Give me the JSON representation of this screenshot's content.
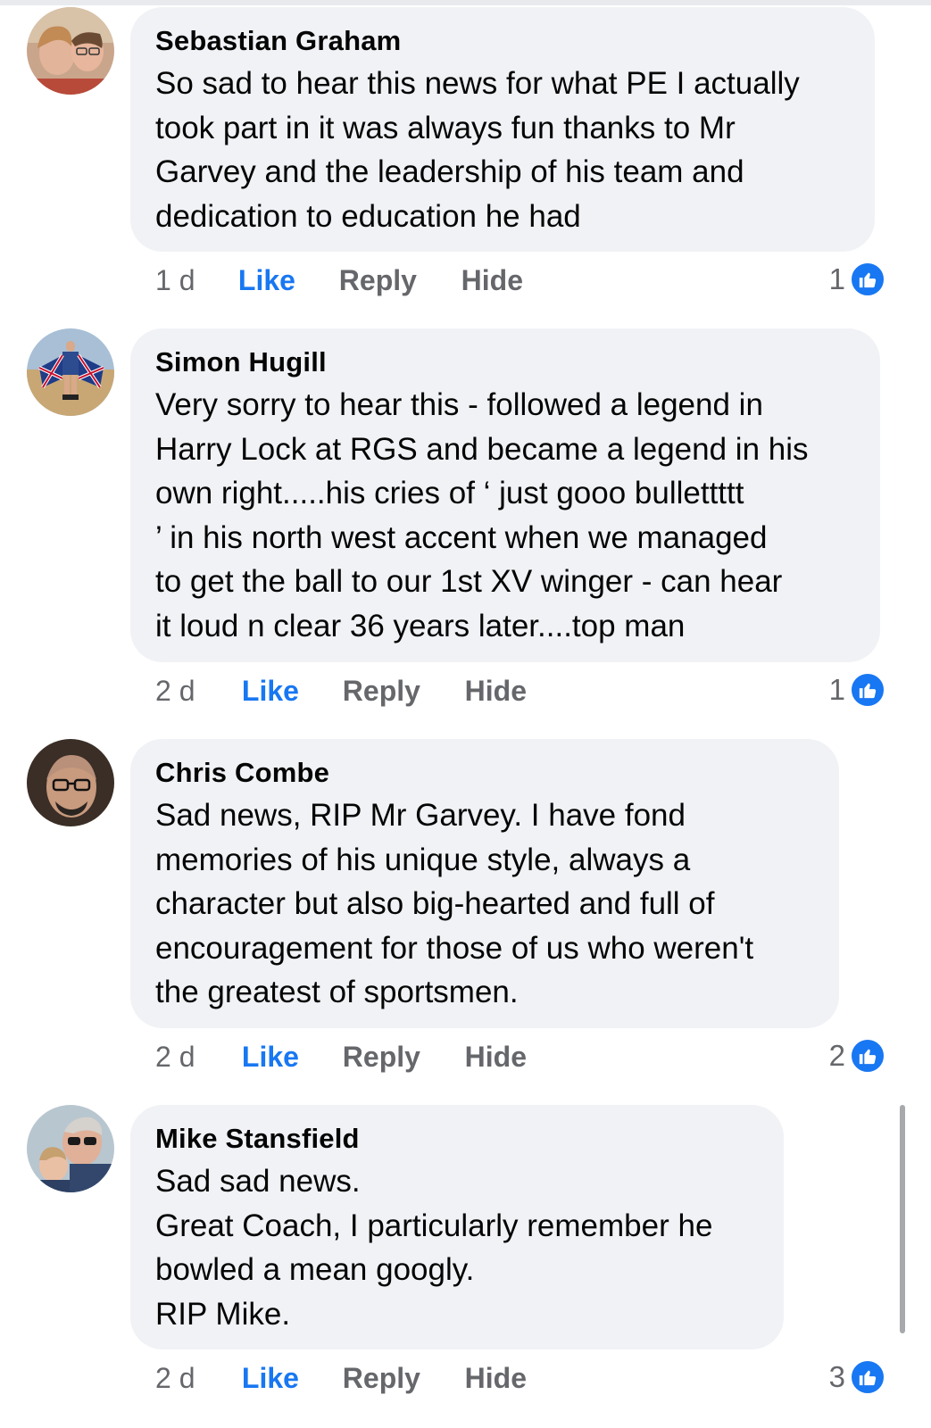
{
  "comments": [
    {
      "author": "Sebastian Graham",
      "text": "So sad to hear this news for what PE I actually\ntook part in it was always fun thanks to Mr\nGarvey and the leadership of his team and\ndedication to education he had",
      "time": "1 d",
      "like_label": "Like",
      "reply_label": "Reply",
      "hide_label": "Hide",
      "reaction_count": "1",
      "reaction_icon": "thumbs-up-icon"
    },
    {
      "author": "Simon Hugill",
      "text": "Very sorry to hear this - followed a legend in\nHarry Lock at RGS and became a legend in his\nown right.....his cries of ‘ just gooo bullettttt\n’ in his north west accent when we managed\nto get the ball to our 1st XV winger - can hear\nit loud n clear 36 years later....top man",
      "time": "2 d",
      "like_label": "Like",
      "reply_label": "Reply",
      "hide_label": "Hide",
      "reaction_count": "1",
      "reaction_icon": "thumbs-up-icon"
    },
    {
      "author": "Chris Combe",
      "text": "Sad news, RIP Mr Garvey. I have fond\nmemories of his unique style, always a\ncharacter but also big-hearted and full of\nencouragement for those of us who weren't\nthe greatest of sportsmen.",
      "time": "2 d",
      "like_label": "Like",
      "reply_label": "Reply",
      "hide_label": "Hide",
      "reaction_count": "2",
      "reaction_icon": "thumbs-up-icon"
    },
    {
      "author": "Mike Stansfield",
      "text": "Sad sad news.\nGreat Coach, I particularly remember he\nbowled a mean googly.\nRIP Mike.",
      "time": "2 d",
      "like_label": "Like",
      "reply_label": "Reply",
      "hide_label": "Hide",
      "reaction_count": "3",
      "reaction_icon": "thumbs-up-icon"
    }
  ],
  "colors": {
    "bubble": "#f0f2f5",
    "like_blue": "#1877f2",
    "meta_gray": "#65676b",
    "text": "#050505"
  }
}
